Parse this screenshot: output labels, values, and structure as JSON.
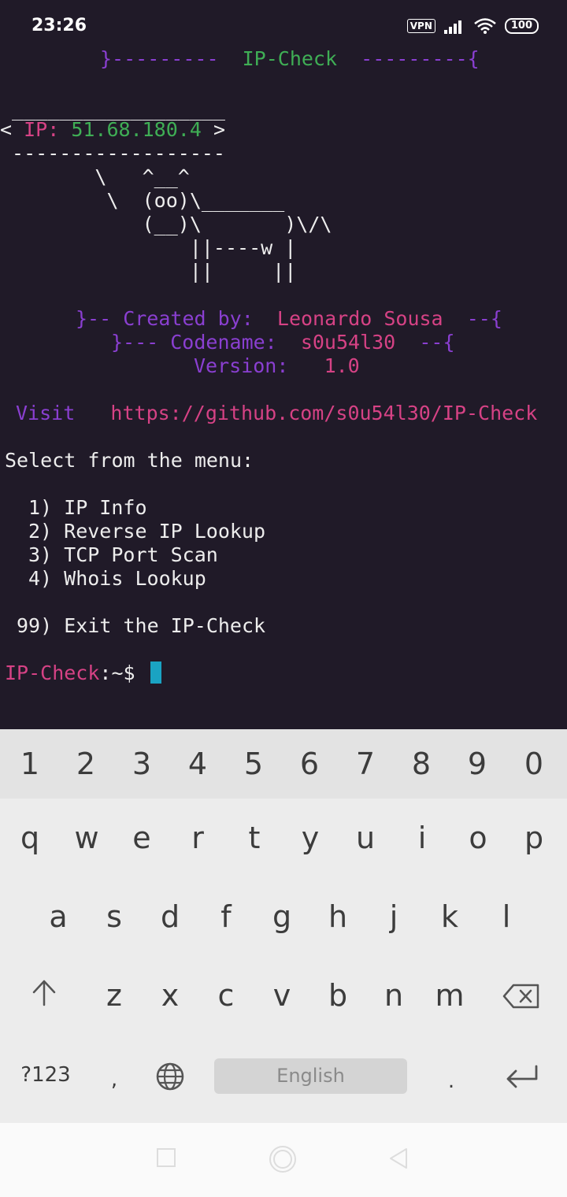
{
  "status_bar": {
    "time": "23:26",
    "vpn_label": "VPN",
    "battery": "100"
  },
  "terminal": {
    "banner_left": "}---------",
    "banner_title": "IP-Check",
    "banner_right": "---------{",
    "bubble_top": " __________________",
    "bubble_open": "< ",
    "ip_label": "IP:",
    "ip_value": "51.68.180.4",
    "bubble_close": " >",
    "bubble_bottom": " ------------------",
    "cow_lines": [
      "        \\   ^__^",
      "         \\  (oo)\\_______",
      "            (__)\\       )\\/\\",
      "                ||----w |",
      "                ||     ||"
    ],
    "created_prefix": "}-- Created by:",
    "created_name": "Leonardo Sousa",
    "created_suffix": "--{",
    "codename_prefix": "}--- Codename:",
    "codename_value": "s0u54l30",
    "codename_suffix": "--{",
    "version_label": "Version:",
    "version_value": "1.0",
    "visit_label": "Visit",
    "visit_url": "https://github.com/s0u54l30/IP-Check",
    "menu_title": "Select from the menu:",
    "menu_items": [
      "1) IP Info",
      "2) Reverse IP Lookup",
      "3) TCP Port Scan",
      "4) Whois Lookup"
    ],
    "exit_item": "99) Exit the IP-Check",
    "prompt_name": "IP-Check",
    "prompt_rest": ":~$"
  },
  "keyboard": {
    "number_row": [
      "1",
      "2",
      "3",
      "4",
      "5",
      "6",
      "7",
      "8",
      "9",
      "0"
    ],
    "row1": [
      "q",
      "w",
      "e",
      "r",
      "t",
      "y",
      "u",
      "i",
      "o",
      "p"
    ],
    "row2": [
      "a",
      "s",
      "d",
      "f",
      "g",
      "h",
      "j",
      "k",
      "l"
    ],
    "row3": [
      "z",
      "x",
      "c",
      "v",
      "b",
      "n",
      "m"
    ],
    "symbols_key": "?123",
    "comma_key": ",",
    "space_label": "English",
    "period_key": "."
  },
  "colors": {
    "terminal_bg": "#201a28",
    "purple": "#8a3fd1",
    "green": "#3fae55",
    "pink": "#d64285",
    "cursor": "#1aa3c3"
  }
}
